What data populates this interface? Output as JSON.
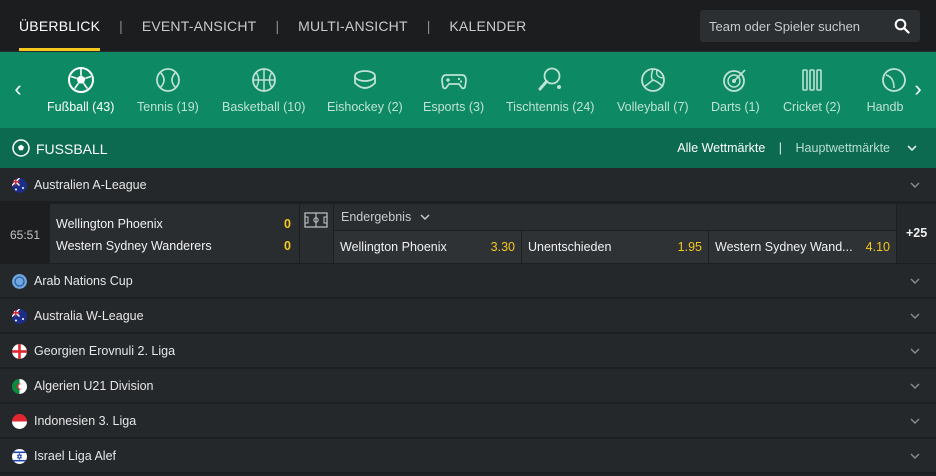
{
  "nav": {
    "tabs": [
      {
        "label": "ÜBERBLICK",
        "active": true
      },
      {
        "label": "EVENT-ANSICHT"
      },
      {
        "label": "MULTI-ANSICHT"
      },
      {
        "label": "KALENDER"
      }
    ],
    "separator": "|",
    "search_placeholder": "Team oder Spieler suchen"
  },
  "sports": [
    {
      "label": "Fußball (43)",
      "icon": "soccer-ball-icon",
      "active": true
    },
    {
      "label": "Tennis (19)",
      "icon": "tennis-ball-icon"
    },
    {
      "label": "Basketball (10)",
      "icon": "basketball-icon"
    },
    {
      "label": "Eishockey (2)",
      "icon": "ice-hockey-puck-icon"
    },
    {
      "label": "Esports (3)",
      "icon": "gamepad-icon"
    },
    {
      "label": "Tischtennis (24)",
      "icon": "table-tennis-icon"
    },
    {
      "label": "Volleyball (7)",
      "icon": "volleyball-icon"
    },
    {
      "label": "Darts (1)",
      "icon": "dartboard-icon"
    },
    {
      "label": "Cricket (2)",
      "icon": "cricket-icon"
    },
    {
      "label": "Handb",
      "icon": "handball-icon"
    }
  ],
  "section": {
    "title": "FUSSBALL",
    "markets_all": "Alle Wettmärkte",
    "markets_sep": "|",
    "markets_main": "Hauptwettmärkte"
  },
  "leagues": [
    {
      "name": "Australien A-League",
      "flag": "australia-flag-icon"
    },
    {
      "name": "Arab Nations Cup",
      "flag": "international-icon"
    },
    {
      "name": "Australia W-League",
      "flag": "australia-flag-icon"
    },
    {
      "name": "Georgien Erovnuli 2. Liga",
      "flag": "georgia-flag-icon"
    },
    {
      "name": "Algerien U21 Division",
      "flag": "algeria-flag-icon"
    },
    {
      "name": "Indonesien 3. Liga",
      "flag": "indonesia-flag-icon"
    },
    {
      "name": "Israel Liga Alef",
      "flag": "israel-flag-icon"
    }
  ],
  "match": {
    "time": "65:51",
    "home": "Wellington Phoenix",
    "away": "Western Sydney Wanderers",
    "home_score": "0",
    "away_score": "0",
    "market_label": "Endergebnis",
    "odds": [
      {
        "name": "Wellington Phoenix",
        "value": "3.30"
      },
      {
        "name": "Unentschieden",
        "value": "1.95"
      },
      {
        "name": "Western Sydney Wand...",
        "value": "4.10"
      }
    ],
    "more_markets": "+25"
  },
  "colors": {
    "accent": "#f4c81d",
    "sportbar": "#0d8a63",
    "section_header": "#0b6a4f"
  }
}
